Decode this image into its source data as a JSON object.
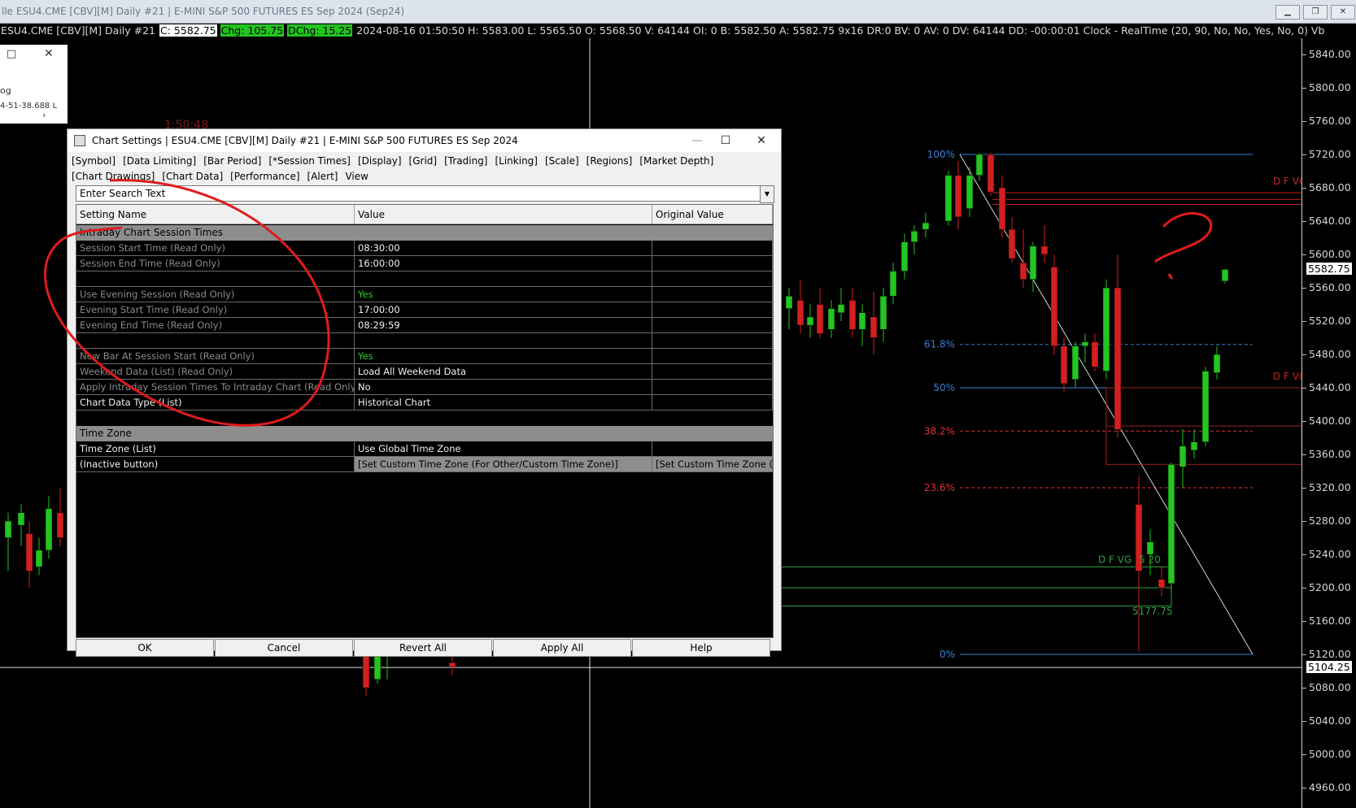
{
  "window": {
    "title": "lle ESU4.CME [CBV][M]  Daily #21 | E-MINI S&P 500 FUTURES ES Sep 2024 (Sep24)",
    "buttons": [
      "minimize",
      "restore",
      "close"
    ]
  },
  "info_bar": {
    "symbol": "ESU4.CME [CBV][M]  Daily #21",
    "close": "C: 5582.75",
    "chg": "Chg: 105.75",
    "dchg": "DChg: 15.25",
    "details": "2024-08-16 01:50:50 H: 5583.00 L: 5565.50 O: 5568.50 V: 64144 OI: 0 B: 5582.50 A: 5582.75 9x16 DR:0 BV: 0 AV: 0 DV: 64144 DD: -00:00:01 Clock - RealTime    (20, 90, No, No, Yes, No, 0)  Vb"
  },
  "mini_window": {
    "text1": "og",
    "text2": "4-51-38.688 L"
  },
  "clock_text": "1:50:48",
  "price_axis": {
    "labels": [
      "5840.00",
      "5800.00",
      "5760.00",
      "5720.00",
      "5680.00",
      "5640.00",
      "5600.00",
      "5560.00",
      "5520.00",
      "5480.00",
      "5440.00",
      "5400.00",
      "5360.00",
      "5320.00",
      "5280.00",
      "5240.00",
      "5200.00",
      "5160.00",
      "5120.00",
      "5080.00",
      "5040.00",
      "5000.00",
      "4960.00"
    ],
    "current_price": "5582.75",
    "crosshair_price": "5104.25"
  },
  "fib_levels": [
    {
      "label": "100%",
      "color": "#3a7fd5"
    },
    {
      "label": "61.8%",
      "color": "#3a7fd5"
    },
    {
      "label": "50%",
      "color": "#3a7fd5"
    },
    {
      "label": "38.2%",
      "color": "#e03232"
    },
    {
      "label": "23.6%",
      "color": "#e03232"
    },
    {
      "label": "0%",
      "color": "#3a7fd5"
    }
  ],
  "annotations": {
    "dfvg_upper": "D F VG",
    "dfvg_mid": "D F VG",
    "dfvg_low": "D F VG",
    "low_label": "5177.75",
    "low_label2": "5 20",
    "question_mark": "?"
  },
  "chart_data": {
    "type": "candlestick",
    "title": "",
    "ylabel": "",
    "ylim": [
      4940,
      5860
    ],
    "candles": [
      {
        "o": 5260,
        "h": 5290,
        "l": 5220,
        "c": 5280,
        "up": true
      },
      {
        "o": 5275,
        "h": 5300,
        "l": 5250,
        "c": 5290,
        "up": true
      },
      {
        "o": 5265,
        "h": 5280,
        "l": 5200,
        "c": 5220,
        "up": false
      },
      {
        "o": 5225,
        "h": 5260,
        "l": 5215,
        "c": 5245,
        "up": true
      },
      {
        "o": 5245,
        "h": 5310,
        "l": 5235,
        "c": 5295,
        "up": true
      },
      {
        "o": 5290,
        "h": 5320,
        "l": 5250,
        "c": 5260,
        "up": false
      },
      {
        "o": 5120,
        "h": 5135,
        "l": 5070,
        "c": 5080,
        "up": false
      },
      {
        "o": 5090,
        "h": 5130,
        "l": 5085,
        "c": 5120,
        "up": true
      },
      {
        "o": 5120,
        "h": 5140,
        "l": 5090,
        "c": 5130,
        "up": true
      },
      {
        "o": 5110,
        "h": 5125,
        "l": 5095,
        "c": 5105,
        "up": false
      },
      {
        "o": 5495,
        "h": 5540,
        "l": 5480,
        "c": 5530,
        "up": true
      },
      {
        "o": 5535,
        "h": 5560,
        "l": 5510,
        "c": 5550,
        "up": true
      },
      {
        "o": 5545,
        "h": 5570,
        "l": 5505,
        "c": 5515,
        "up": false
      },
      {
        "o": 5515,
        "h": 5540,
        "l": 5500,
        "c": 5525,
        "up": true
      },
      {
        "o": 5540,
        "h": 5560,
        "l": 5500,
        "c": 5505,
        "up": false
      },
      {
        "o": 5510,
        "h": 5545,
        "l": 5500,
        "c": 5535,
        "up": true
      },
      {
        "o": 5530,
        "h": 5560,
        "l": 5520,
        "c": 5540,
        "up": true
      },
      {
        "o": 5545,
        "h": 5560,
        "l": 5500,
        "c": 5510,
        "up": false
      },
      {
        "o": 5510,
        "h": 5540,
        "l": 5490,
        "c": 5530,
        "up": true
      },
      {
        "o": 5525,
        "h": 5555,
        "l": 5480,
        "c": 5500,
        "up": false
      },
      {
        "o": 5510,
        "h": 5560,
        "l": 5495,
        "c": 5550,
        "up": true
      },
      {
        "o": 5550,
        "h": 5590,
        "l": 5540,
        "c": 5580,
        "up": true
      },
      {
        "o": 5580,
        "h": 5625,
        "l": 5570,
        "c": 5615,
        "up": true
      },
      {
        "o": 5615,
        "h": 5635,
        "l": 5600,
        "c": 5628,
        "up": true
      },
      {
        "o": 5630,
        "h": 5650,
        "l": 5620,
        "c": 5638,
        "up": true
      },
      {
        "o": 5640,
        "h": 5700,
        "l": 5635,
        "c": 5695,
        "up": true
      },
      {
        "o": 5695,
        "h": 5712,
        "l": 5630,
        "c": 5645,
        "up": false
      },
      {
        "o": 5655,
        "h": 5705,
        "l": 5645,
        "c": 5695,
        "up": true
      },
      {
        "o": 5695,
        "h": 5722,
        "l": 5688,
        "c": 5720,
        "up": true
      },
      {
        "o": 5720,
        "h": 5722,
        "l": 5670,
        "c": 5675,
        "up": false
      },
      {
        "o": 5680,
        "h": 5695,
        "l": 5620,
        "c": 5630,
        "up": false
      },
      {
        "o": 5630,
        "h": 5645,
        "l": 5590,
        "c": 5595,
        "up": false
      },
      {
        "o": 5590,
        "h": 5630,
        "l": 5560,
        "c": 5570,
        "up": false
      },
      {
        "o": 5570,
        "h": 5615,
        "l": 5555,
        "c": 5610,
        "up": true
      },
      {
        "o": 5610,
        "h": 5635,
        "l": 5590,
        "c": 5600,
        "up": false
      },
      {
        "o": 5585,
        "h": 5600,
        "l": 5480,
        "c": 5490,
        "up": false
      },
      {
        "o": 5490,
        "h": 5500,
        "l": 5435,
        "c": 5445,
        "up": false
      },
      {
        "o": 5450,
        "h": 5495,
        "l": 5440,
        "c": 5490,
        "up": true
      },
      {
        "o": 5490,
        "h": 5505,
        "l": 5470,
        "c": 5495,
        "up": true
      },
      {
        "o": 5495,
        "h": 5505,
        "l": 5460,
        "c": 5465,
        "up": false
      },
      {
        "o": 5460,
        "h": 5570,
        "l": 5450,
        "c": 5560,
        "up": true
      },
      {
        "o": 5560,
        "h": 5600,
        "l": 5380,
        "c": 5390,
        "up": false
      },
      {
        "o": 5300,
        "h": 5335,
        "l": 5123,
        "c": 5220,
        "up": false
      },
      {
        "o": 5240,
        "h": 5270,
        "l": 5215,
        "c": 5255,
        "up": true
      },
      {
        "o": 5210,
        "h": 5225,
        "l": 5190,
        "c": 5200,
        "up": false
      },
      {
        "o": 5205,
        "h": 5350,
        "l": 5195,
        "c": 5348,
        "up": true
      },
      {
        "o": 5345,
        "h": 5390,
        "l": 5320,
        "c": 5370,
        "up": true
      },
      {
        "o": 5365,
        "h": 5390,
        "l": 5355,
        "c": 5375,
        "up": true
      },
      {
        "o": 5375,
        "h": 5465,
        "l": 5370,
        "c": 5460,
        "up": true
      },
      {
        "o": 5458,
        "h": 5490,
        "l": 5450,
        "c": 5480,
        "up": true
      },
      {
        "o": 5568,
        "h": 5583,
        "l": 5565,
        "c": 5582,
        "up": true
      }
    ]
  },
  "dialog": {
    "title": "Chart Settings | ESU4.CME [CBV][M]  Daily #21 | E-MINI S&P 500 FUTURES ES Sep 2024",
    "tabs": [
      "[Symbol]",
      "[Data Limiting]",
      "[Bar Period]",
      "[*Session Times]",
      "[Display]",
      "[Grid]",
      "[Trading]",
      "[Linking]",
      "[Scale]",
      "[Regions]",
      "[Market Depth]",
      "[Chart Drawings]",
      "[Chart Data]",
      "[Performance]",
      "[Alert]",
      "View"
    ],
    "search_placeholder": "Enter Search Text",
    "columns": [
      "Setting Name",
      "Value",
      "Original Value"
    ],
    "section1": "Intraday Chart Session Times",
    "section2": "Time Zone",
    "rows": [
      {
        "name": "Session Start Time (Read Only)",
        "value": "08:30:00",
        "orig": ""
      },
      {
        "name": "Session End Time (Read Only)",
        "value": "16:00:00",
        "orig": ""
      },
      {
        "name": "Use Evening Session (Read Only)",
        "value": "Yes",
        "orig": ""
      },
      {
        "name": "Evening Start Time (Read Only)",
        "value": "17:00:00",
        "orig": ""
      },
      {
        "name": "Evening End Time (Read Only)",
        "value": "08:29:59",
        "orig": ""
      },
      {
        "name": "New Bar At Session Start (Read Only)",
        "value": "Yes",
        "orig": ""
      },
      {
        "name": "Weekend Data (List) (Read Only)",
        "value": "Load All Weekend Data",
        "orig": ""
      },
      {
        "name": "Apply Intraday Session Times To Intraday Chart (Read Only)",
        "value": "No",
        "orig": ""
      },
      {
        "name": "Chart Data Type (List)",
        "value": "Historical Chart",
        "orig": ""
      }
    ],
    "tz_rows": [
      {
        "name": "Time Zone (List)",
        "value": "Use Global Time Zone",
        "orig": ""
      },
      {
        "name": " (Inactive button)",
        "value": "[Set Custom Time Zone (For Other/Custom Time Zone)]",
        "orig": "[Set Custom Time Zone (For Other/Custom Time Zone)]"
      }
    ],
    "buttons": {
      "ok": "OK",
      "cancel": "Cancel",
      "revert": "Revert All",
      "apply": "Apply All",
      "help": "Help"
    }
  }
}
